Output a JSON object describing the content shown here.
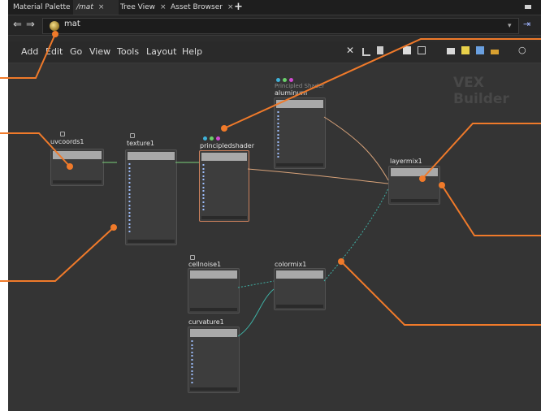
{
  "tabs": [
    {
      "label": "Material Palette",
      "close": "×"
    },
    {
      "label": "/mat",
      "close": "×"
    },
    {
      "label": "Tree View",
      "close": "×"
    },
    {
      "label": "Asset Browser",
      "close": "×"
    }
  ],
  "tab_add": "+",
  "path": {
    "network": "mat",
    "back_icon": "back-arrow-icon",
    "forward_icon": "forward-arrow-icon"
  },
  "menu": [
    "Add",
    "Edit",
    "Go",
    "View",
    "Tools",
    "Layout",
    "Help"
  ],
  "watermark": "VEX Builder",
  "nodes": {
    "uvcoords": {
      "name": "uvcoords1"
    },
    "texture": {
      "name": "texture1"
    },
    "principled": {
      "name": "principledshader"
    },
    "aluminum": {
      "name": "aluminum",
      "type_label": "Principled Shader"
    },
    "layermix": {
      "name": "layermix1"
    },
    "cellnoise": {
      "name": "cellnoise1"
    },
    "colormix": {
      "name": "colormix1"
    },
    "curvature": {
      "name": "curvature1"
    }
  },
  "colors": {
    "annotation": "#f07a2a",
    "background": "#343434",
    "wire": "#d9a37a",
    "wire_dotted": "#3fb2a6"
  }
}
